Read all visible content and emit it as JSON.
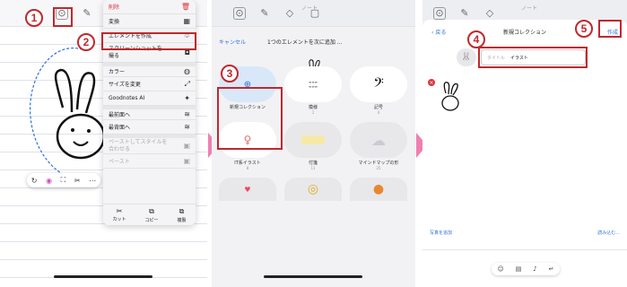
{
  "panel1": {
    "menu": {
      "delete": "削除",
      "transform": "変換",
      "create_element": "エレメントを作成",
      "screenshot": "スクリーンショットを撮る",
      "color": "カラー",
      "resize": "サイズを変更",
      "goodnotes_ai": "Goodnotes AI",
      "bring_front": "最前面へ",
      "send_back": "最背面へ",
      "paste_style": "ペーストしてスタイルを合わせる",
      "paste": "ペースト",
      "cut": "カット",
      "copy": "コピー",
      "duplicate": "複製"
    }
  },
  "panel2": {
    "title": "ノート",
    "cancel": "キャンセル",
    "header": "1つのエレメントを次に追加 ...",
    "items": [
      {
        "name": "新規コレクション",
        "count": ""
      },
      {
        "name": "模様",
        "count": "1"
      },
      {
        "name": "記号",
        "count": "4"
      },
      {
        "name": "IT系イラスト",
        "count": "8"
      },
      {
        "name": "付箋",
        "count": "11"
      },
      {
        "name": "マインドマップの形",
        "count": "25"
      }
    ]
  },
  "panel3": {
    "title": "ノート",
    "back": "戻る",
    "header": "新規コレクション",
    "done": "作成",
    "title_label": "タイトル",
    "title_value": "イラスト",
    "add_photo": "写真を追加",
    "import": "読み込む..."
  },
  "badges": [
    "1",
    "2",
    "3",
    "4",
    "5"
  ],
  "colors": {
    "accent": "#2f6fd6",
    "highlight": "#c0282d",
    "arrow": "#f07fb0"
  }
}
